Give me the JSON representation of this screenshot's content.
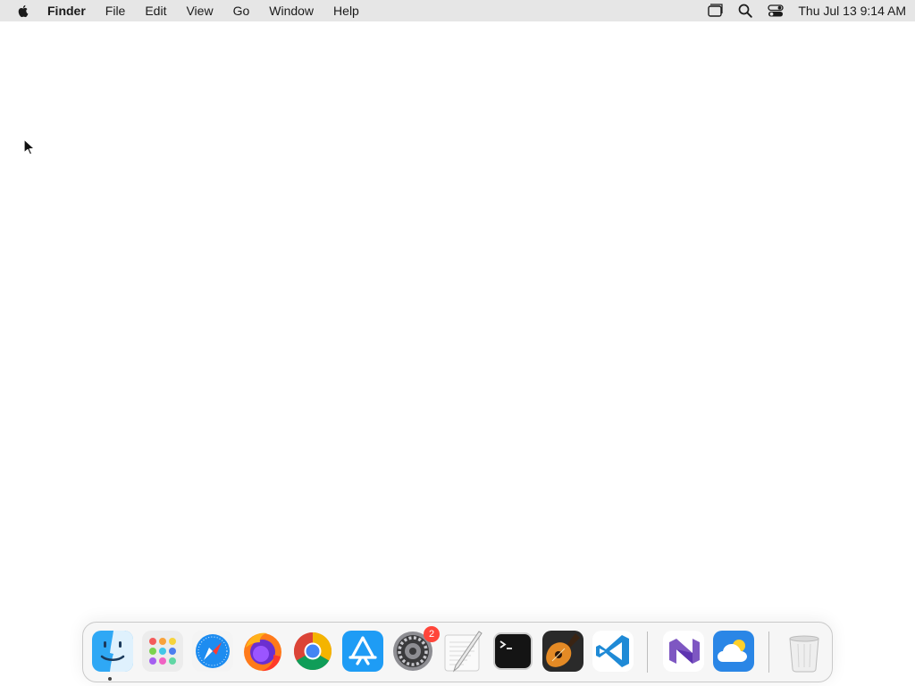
{
  "menubar": {
    "apple_icon": "apple-icon",
    "app_name": "Finder",
    "items": [
      "File",
      "Edit",
      "View",
      "Go",
      "Window",
      "Help"
    ],
    "status_icons": [
      "stage-manager-icon",
      "spotlight-search-icon",
      "control-center-icon"
    ],
    "clock": "Thu Jul 13  9:14 AM"
  },
  "dock": {
    "apps": [
      {
        "name": "Finder",
        "icon": "finder-icon",
        "running": true
      },
      {
        "name": "Launchpad",
        "icon": "launchpad-icon"
      },
      {
        "name": "Safari",
        "icon": "safari-icon"
      },
      {
        "name": "Firefox",
        "icon": "firefox-icon"
      },
      {
        "name": "Google Chrome",
        "icon": "chrome-icon"
      },
      {
        "name": "App Store",
        "icon": "app-store-icon"
      },
      {
        "name": "System Settings",
        "icon": "system-settings-icon",
        "badge": "2"
      },
      {
        "name": "TextEdit",
        "icon": "textedit-icon"
      },
      {
        "name": "Terminal",
        "icon": "terminal-icon"
      },
      {
        "name": "GarageBand",
        "icon": "garageband-icon"
      },
      {
        "name": "Visual Studio Code",
        "icon": "vscode-icon"
      },
      {
        "name": "Visual Studio",
        "icon": "visual-studio-icon"
      },
      {
        "name": "Weather",
        "icon": "weather-icon"
      },
      {
        "name": "Trash",
        "icon": "trash-icon"
      }
    ]
  },
  "colors": {
    "menubar_bg": "#e6e6e6",
    "desktop_bg": "#ffffff",
    "badge": "#ff453a"
  }
}
